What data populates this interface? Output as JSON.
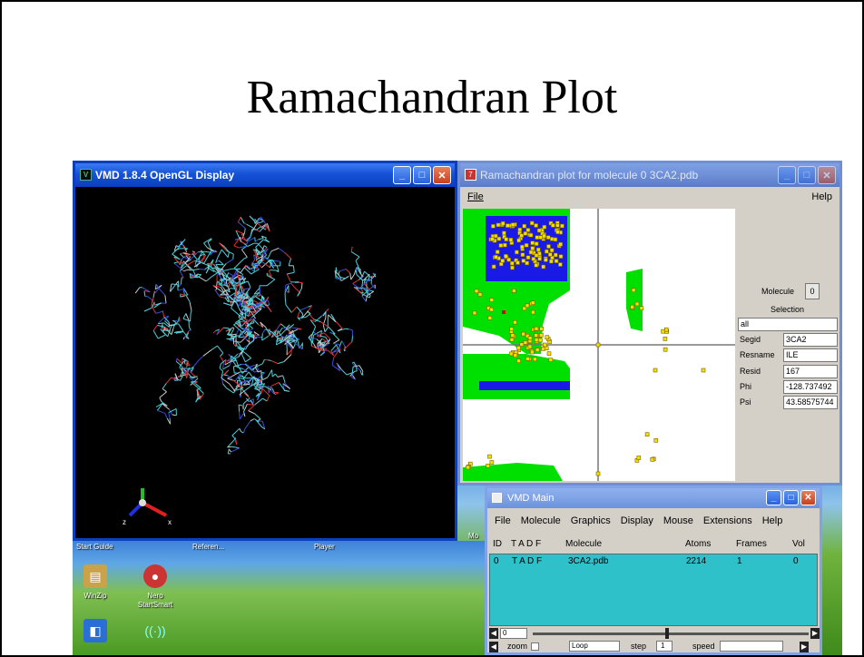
{
  "slide": {
    "title": "Ramachandran Plot"
  },
  "vmd_display": {
    "title": "VMD 1.8.4 OpenGL Display",
    "axes": {
      "x": "x",
      "z": "z"
    }
  },
  "desktop": {
    "shortcuts_top": [
      "Start Guide",
      "Referen...",
      "Player"
    ],
    "side_label": "Mo",
    "icons": [
      {
        "label": "WinZip",
        "icon": "winzip-icon"
      },
      {
        "label": "Nero StartSmart",
        "icon": "nero-icon"
      }
    ]
  },
  "ramachandran": {
    "title": "Ramachandran plot for molecule 0 3CA2.pdb",
    "menu": {
      "file": "File",
      "help": "Help"
    },
    "molecule_label": "Molecule",
    "molecule_value": "0",
    "selection_label": "Selection",
    "selection_value": "all",
    "fields": [
      {
        "label": "Segid",
        "value": "3CA2"
      },
      {
        "label": "Resname",
        "value": "ILE"
      },
      {
        "label": "Resid",
        "value": "167"
      },
      {
        "label": "Phi",
        "value": "-128.737492"
      },
      {
        "label": "Psi",
        "value": "43.58575744"
      }
    ],
    "colors": {
      "allowed": "#00e000",
      "core": "#1a1ae6",
      "point": "#f0e000",
      "selected": "#e00000"
    }
  },
  "vmd_main": {
    "title": "VMD Main",
    "menu": [
      "File",
      "Molecule",
      "Graphics",
      "Display",
      "Mouse",
      "Extensions",
      "Help"
    ],
    "columns": {
      "id": "ID",
      "tadf": "T A D F",
      "molecule": "Molecule",
      "atoms": "Atoms",
      "frames": "Frames",
      "vol": "Vol"
    },
    "rows": [
      {
        "id": "0",
        "tadf": "T A D F",
        "molecule": "3CA2.pdb",
        "atoms": "2214",
        "frames": "1",
        "vol": "0"
      }
    ],
    "frame_value": "0",
    "zoom_label": "zoom",
    "loop_value": "Loop",
    "step_label": "step",
    "step_value": "1",
    "speed_label": "speed"
  }
}
